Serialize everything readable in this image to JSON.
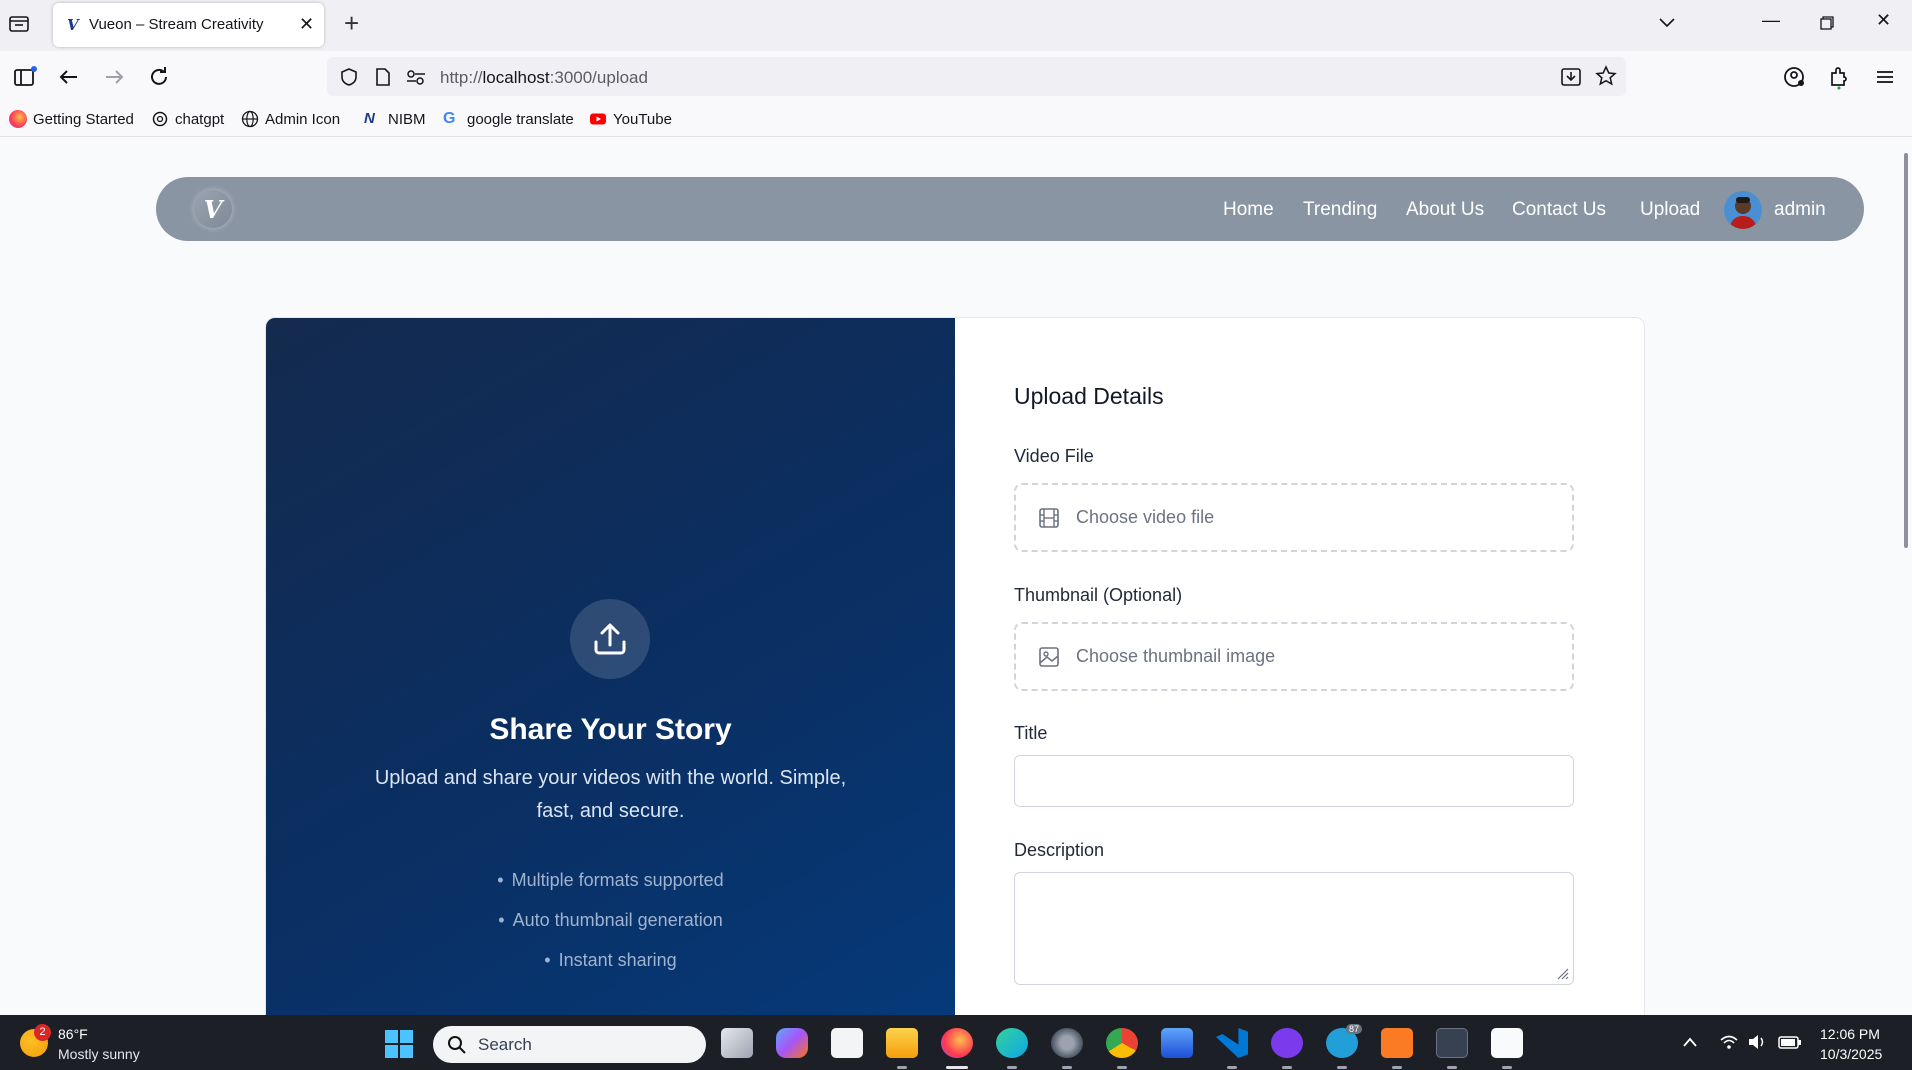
{
  "browser": {
    "tab_title": "Vueon – Stream Creativity",
    "tab_favicon_letter": "V",
    "url_prefix": "http://",
    "url_host": "localhost",
    "url_rest": ":3000/upload",
    "bookmarks": [
      {
        "label": "Getting Started",
        "icon": "firefox-icon"
      },
      {
        "label": "chatgpt",
        "icon": "chatgpt-icon"
      },
      {
        "label": "Admin Icon",
        "icon": "globe-icon"
      },
      {
        "label": "NIBM",
        "icon": "nibm-icon"
      },
      {
        "label": "google translate",
        "icon": "google-icon"
      },
      {
        "label": "YouTube",
        "icon": "youtube-icon"
      }
    ]
  },
  "site": {
    "logo_letter": "V",
    "nav": [
      "Home",
      "Trending",
      "About Us",
      "Contact Us",
      "Upload"
    ],
    "user_name": "admin"
  },
  "promo": {
    "title": "Share Your Story",
    "description": "Upload and share your videos with the world. Simple, fast, and secure.",
    "features": [
      "Multiple formats supported",
      "Auto thumbnail generation",
      "Instant sharing"
    ]
  },
  "form": {
    "title": "Upload Details",
    "video_label": "Video File",
    "video_placeholder": "Choose video file",
    "thumb_label": "Thumbnail (Optional)",
    "thumb_placeholder": "Choose thumbnail image",
    "title_label": "Title",
    "title_value": "",
    "desc_label": "Description",
    "desc_value": ""
  },
  "taskbar": {
    "weather_temp": "86°F",
    "weather_desc": "Mostly sunny",
    "weather_badge": "2",
    "search_placeholder": "Search",
    "telegram_badge": "87",
    "time": "12:06 PM",
    "date": "10/3/2025"
  }
}
